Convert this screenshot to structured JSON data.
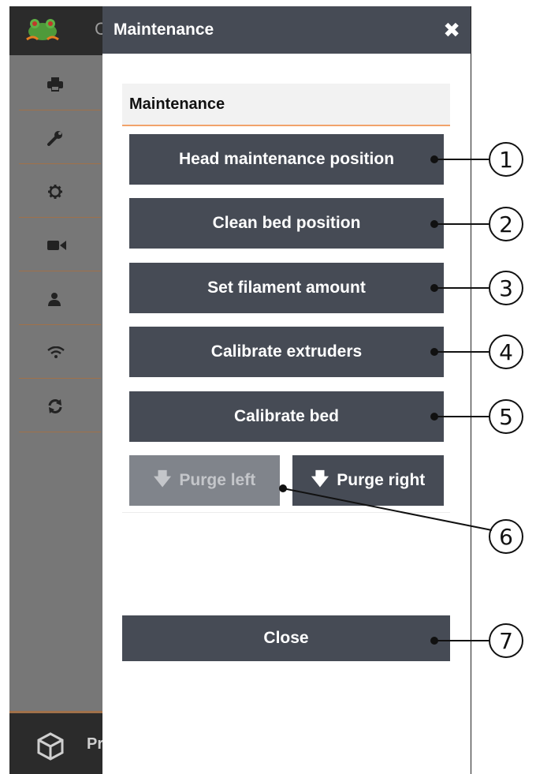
{
  "background_app": {
    "top_bar_partial_text": "C",
    "bottom_bar_partial_text": "Pr",
    "sidebar_icons": [
      "printer-icon",
      "wrench-icon",
      "gear-icon",
      "video-camera-icon",
      "user-icon",
      "wifi-icon",
      "refresh-icon"
    ]
  },
  "modal": {
    "title": "Maintenance",
    "close_icon": "close-icon",
    "section_title": "Maintenance",
    "buttons": {
      "head_maintenance": "Head maintenance position",
      "clean_bed": "Clean bed position",
      "set_filament": "Set filament amount",
      "calibrate_extruders": "Calibrate extruders",
      "calibrate_bed": "Calibrate bed",
      "purge_left": "Purge left",
      "purge_right": "Purge right",
      "close": "Close"
    },
    "purge_left_disabled": true
  },
  "callouts": [
    "1",
    "2",
    "3",
    "4",
    "5",
    "6",
    "7"
  ],
  "colors": {
    "modal_header": "#464b55",
    "button": "#464b55",
    "button_disabled": "#80848b",
    "accent_underline": "#f2a36b",
    "sidebar_divider": "#a0714a"
  }
}
